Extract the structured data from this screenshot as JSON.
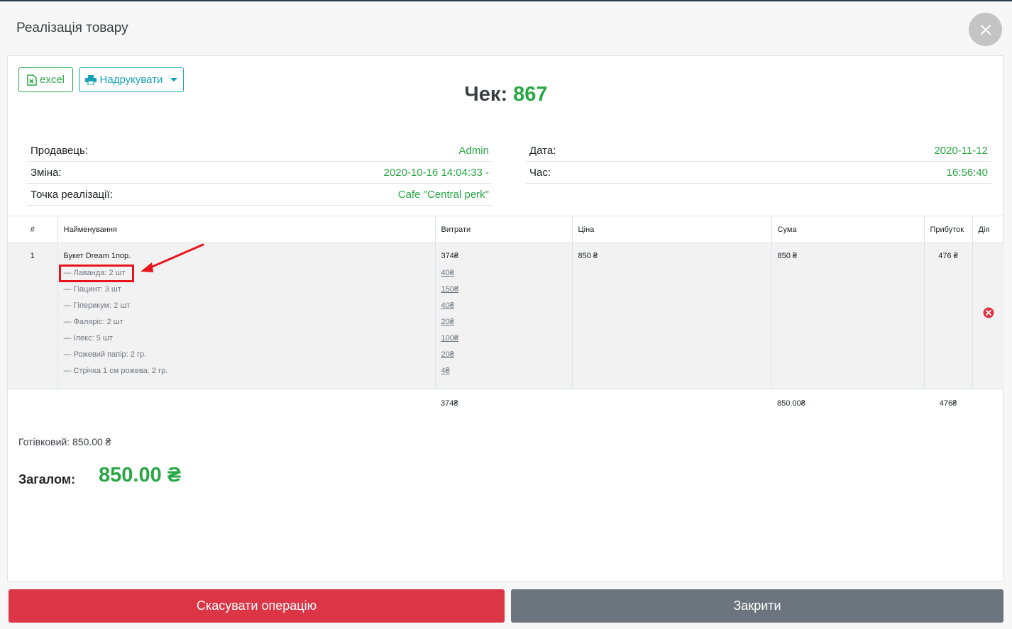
{
  "modal": {
    "title": "Реалізація товару"
  },
  "toolbar": {
    "excel_label": "excel",
    "print_label": "Надрукувати"
  },
  "receipt": {
    "title_label": "Чек:",
    "number": "867"
  },
  "info_left": [
    {
      "label": "Продавець:",
      "value": "Admin"
    },
    {
      "label": "Зміна:",
      "value": "2020-10-16 14:04:33 -"
    },
    {
      "label": "Точка реалізації:",
      "value": "Cafe \"Central perk\""
    }
  ],
  "info_right": [
    {
      "label": "Дата:",
      "value": "2020-11-12"
    },
    {
      "label": "Час:",
      "value": "16:56:40"
    }
  ],
  "table": {
    "headers": [
      "#",
      "Найменування",
      "Витрати",
      "Ціна",
      "Сума",
      "Прибуток",
      "Дія"
    ],
    "rows": [
      {
        "num": "1",
        "name": "Букет Dream 1пор.",
        "cost": "374₴",
        "price": "850 ₴",
        "sum": "850 ₴",
        "profit": "476 ₴",
        "components": [
          {
            "label": "— Лаванда: 2 шт",
            "cost": "40₴"
          },
          {
            "label": "— Гіацинт: 3 шт",
            "cost": "150₴"
          },
          {
            "label": "— Гіперикум: 2 шт",
            "cost": "40₴"
          },
          {
            "label": "— Фаляріс: 2 шт",
            "cost": "20₴"
          },
          {
            "label": "— Ілекс: 5 шт",
            "cost": "100₴"
          },
          {
            "label": "— Рожевий папір: 2 гр.",
            "cost": "20₴"
          },
          {
            "label": "— Стрічка 1 см рожева: 2 гр.",
            "cost": "4₴"
          }
        ]
      }
    ],
    "totals": {
      "cost": "374₴",
      "sum": "850.00₴",
      "profit": "476₴"
    }
  },
  "payment": {
    "cash_text": "Готівковий: 850.00 ₴",
    "total_label": "Загалом:",
    "total_value": "850.00 ₴"
  },
  "footer": {
    "cancel_label": "Скасувати операцію",
    "close_label": "Закрити"
  },
  "colors": {
    "green": "#28a745",
    "info": "#17a2b8",
    "danger": "#dc3545",
    "secondary": "#6c757d",
    "annotation": "#e8141c"
  },
  "icons": {
    "close": "close-icon",
    "excel": "excel-icon",
    "print": "printer-icon",
    "delete": "delete-circle-icon"
  }
}
